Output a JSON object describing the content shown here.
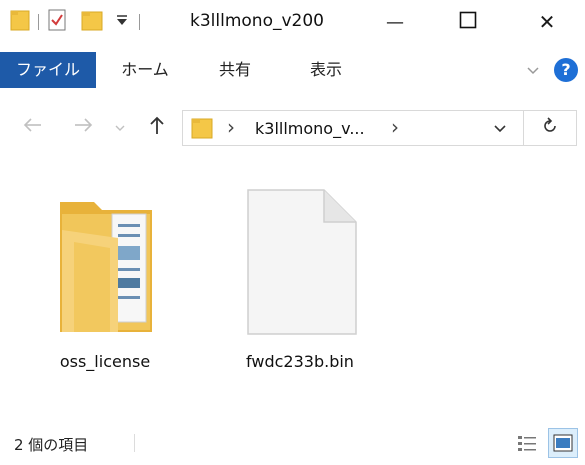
{
  "window": {
    "title": "k3lllmono_v200",
    "minimize_glyph": "—",
    "maximize_glyph": "☐",
    "close_glyph": "✕"
  },
  "ribbon": {
    "tabs": [
      {
        "label": "ファイル"
      },
      {
        "label": "ホーム"
      },
      {
        "label": "共有"
      },
      {
        "label": "表示"
      }
    ],
    "help_glyph": "?"
  },
  "address": {
    "path_label": "k3lllmono_v...",
    "separator_glyph": "›"
  },
  "files": [
    {
      "name": "oss_license",
      "icon": "folder-icon"
    },
    {
      "name": "fwdc233b.bin",
      "icon": "file-icon"
    }
  ],
  "status": {
    "item_count_text": "2 個の項目"
  },
  "colors": {
    "accent": "#1e5aa8",
    "folder": "#f2c94c",
    "help": "#1e6fd6"
  }
}
